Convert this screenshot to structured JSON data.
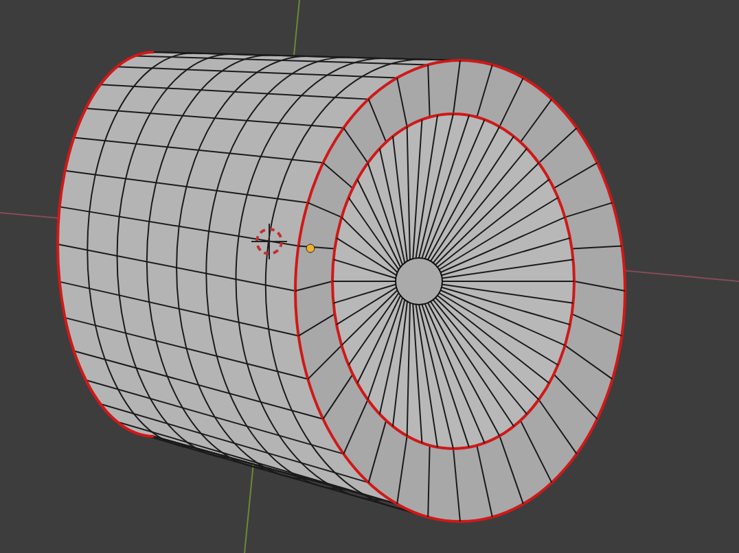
{
  "viewport": {
    "kind": "perspective",
    "object": {
      "kind": "tube",
      "selected_edges": true
    }
  }
}
